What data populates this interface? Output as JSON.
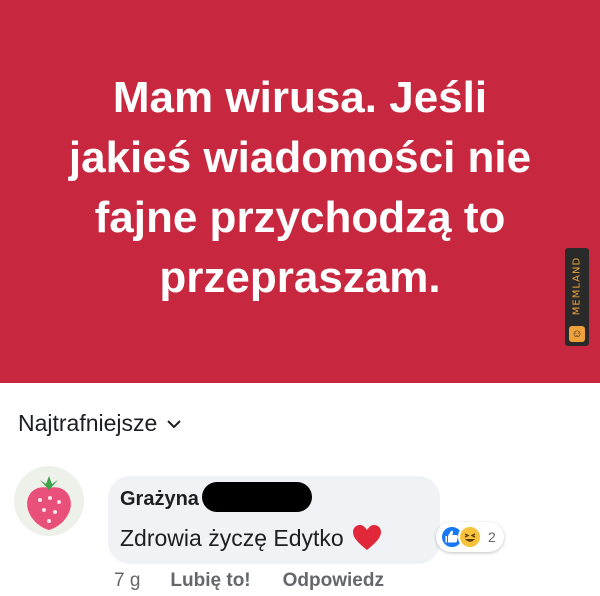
{
  "post": {
    "text": "Mam wirusa. Jeśli\njakieś wiadomości nie\nfajne przychodzą to\nprzepraszam.",
    "background_color": "#c8283f",
    "watermark": {
      "text": "MEMLAND",
      "icon": "smiley-icon"
    }
  },
  "comments_section": {
    "sort_label": "Najtrafniejsze",
    "sort_icon": "chevron-down-icon",
    "comment": {
      "author": "Grażyna",
      "text": "Zdrowia życzę Edytko",
      "emoji": "heart-icon",
      "reactions": {
        "icons": [
          "like-icon",
          "haha-icon"
        ],
        "count": "2"
      },
      "time": "7 g",
      "like_label": "Lubię to!",
      "reply_label": "Odpowiedz"
    }
  }
}
